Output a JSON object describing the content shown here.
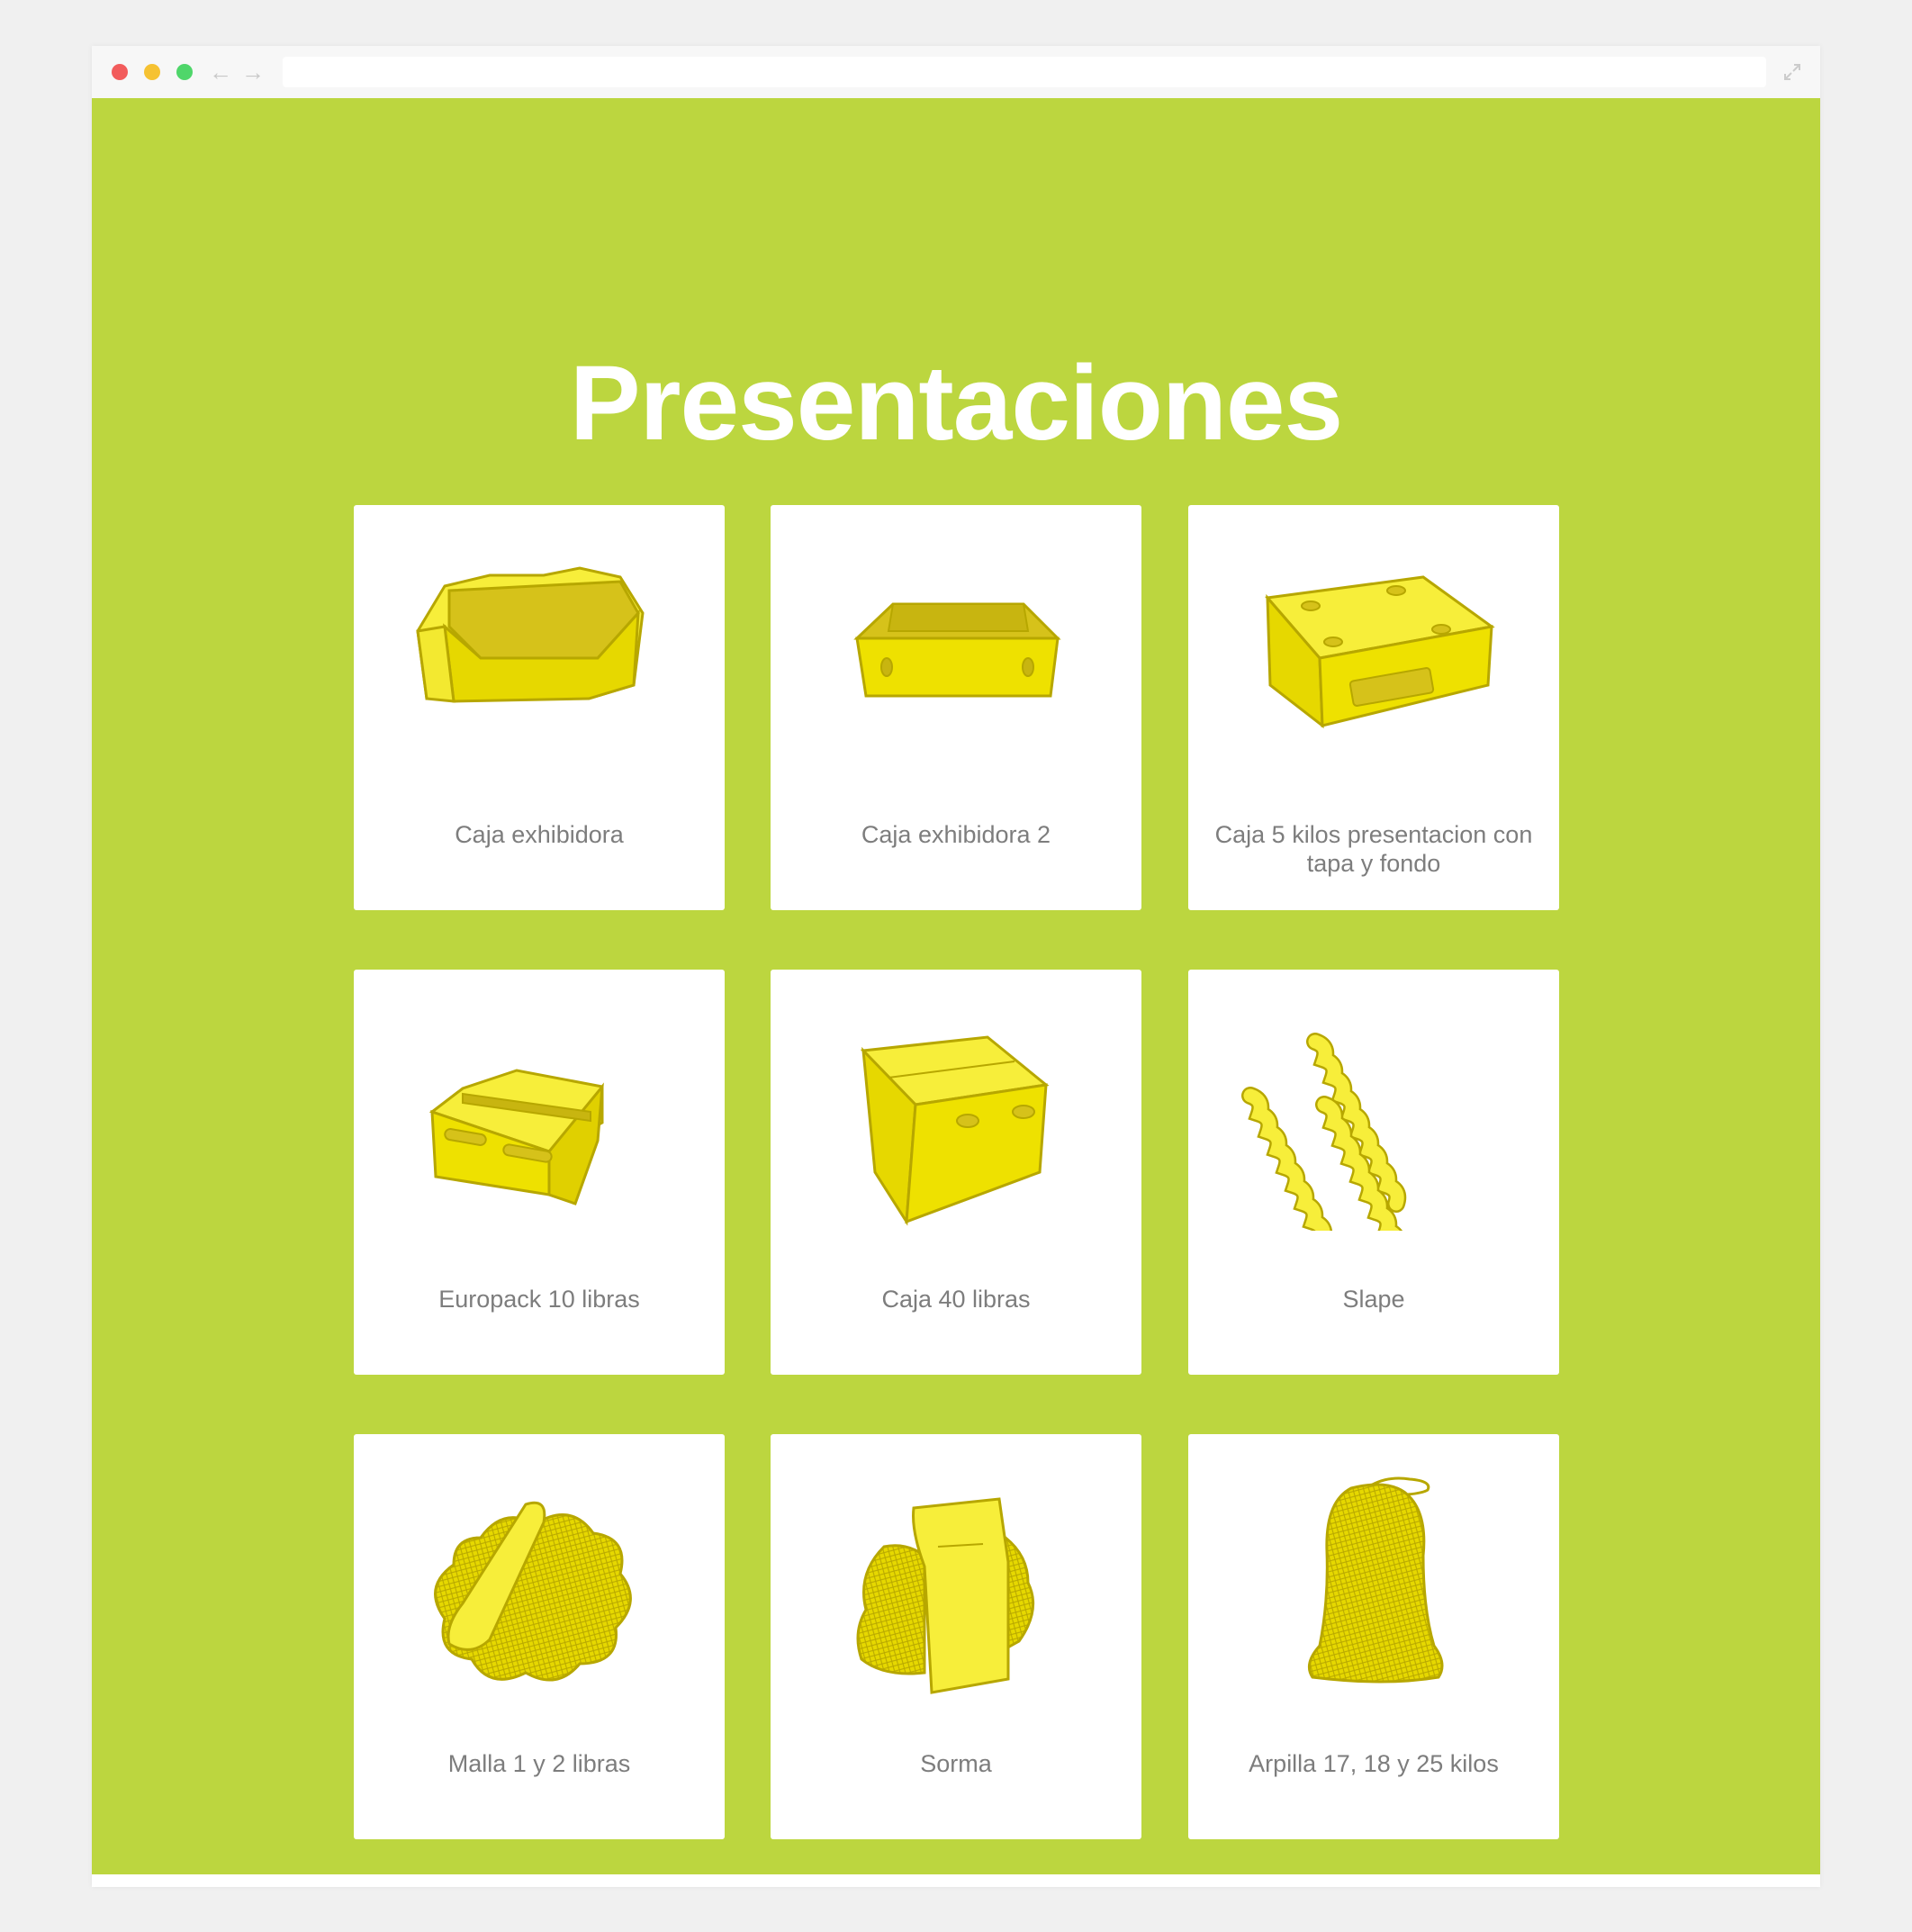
{
  "browser": {
    "address_value": "",
    "back_icon": "arrow-left-icon",
    "forward_icon": "arrow-right-icon",
    "expand_icon": "expand-icon"
  },
  "page": {
    "title": "Presentaciones",
    "colors": {
      "background": "#bcd63f",
      "card": "#ffffff",
      "illustration": "#f0e320",
      "label": "#7d7d7d"
    }
  },
  "products": [
    {
      "label": "Caja exhibidora",
      "icon": "display-box-icon"
    },
    {
      "label": "Caja exhibidora 2",
      "icon": "open-tray-box-icon"
    },
    {
      "label": "Caja 5 kilos presentacion con tapa y fondo",
      "icon": "lidded-box-icon"
    },
    {
      "label": "Europack 10 libras",
      "icon": "europack-box-icon"
    },
    {
      "label": "Caja 40 libras",
      "icon": "large-carton-icon"
    },
    {
      "label": "Slape",
      "icon": "slape-strips-icon"
    },
    {
      "label": "Malla 1 y 2 libras",
      "icon": "mesh-bag-icon"
    },
    {
      "label": "Sorma",
      "icon": "sorma-bag-icon"
    },
    {
      "label": "Arpilla 17, 18 y 25 kilos",
      "icon": "sack-icon"
    }
  ]
}
